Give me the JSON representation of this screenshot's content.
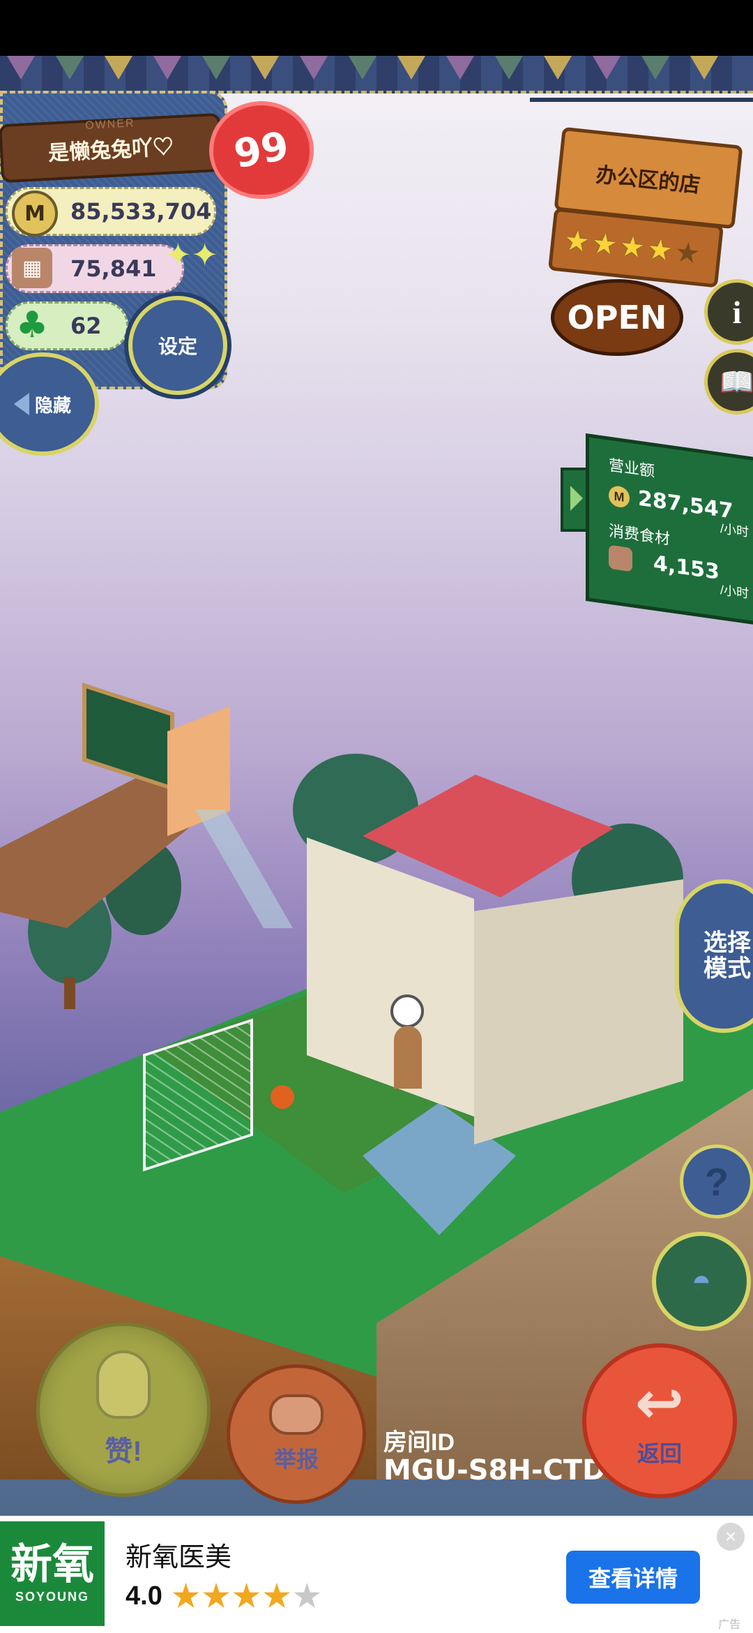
{
  "owner": {
    "label": "OWNER",
    "name": "是懒兔兔吖♡",
    "level": "99"
  },
  "resources": {
    "coins": "85,533,704",
    "food": "75,841",
    "clovers": "62"
  },
  "buttons": {
    "settings": "设定",
    "hide": "隐藏",
    "mode": "选择\n模式",
    "like": "赞!",
    "report": "举报",
    "back": "返回"
  },
  "shop": {
    "name": "办公区的店",
    "rating": 4,
    "rating_max": 5,
    "status": "OPEN"
  },
  "stats": {
    "revenue_label": "营业额",
    "revenue_value": "287,547",
    "revenue_unit": "/小时",
    "food_label": "消费食材",
    "food_value": "4,153",
    "food_unit": "/小时"
  },
  "room": {
    "label": "房间ID",
    "id": "MGU-S8H-CTD"
  },
  "icons": {
    "coin": "coin-icon",
    "food": "food-basket-icon",
    "clover": "clover-icon",
    "sparkle": "sparkle-icon",
    "info": "info-icon",
    "book": "book-icon",
    "help": "question-icon",
    "ufo": "ufo-icon",
    "like": "like-hand-icon",
    "report": "whistle-icon",
    "back": "return-arrow-icon"
  },
  "ad": {
    "logo_text": "新氧",
    "logo_sub": "SOYOUNG",
    "title": "新氧医美",
    "rating": "4.0",
    "stars_filled": 4,
    "stars_total": 5,
    "cta": "查看详情",
    "tag": "广告"
  },
  "colors": {
    "panel_blue": "#3d5d93",
    "accent_yellow": "#d8d465",
    "back_red": "#e9553a",
    "ad_cta_blue": "#1a73e8",
    "ad_logo_green": "#1a8a3a"
  }
}
